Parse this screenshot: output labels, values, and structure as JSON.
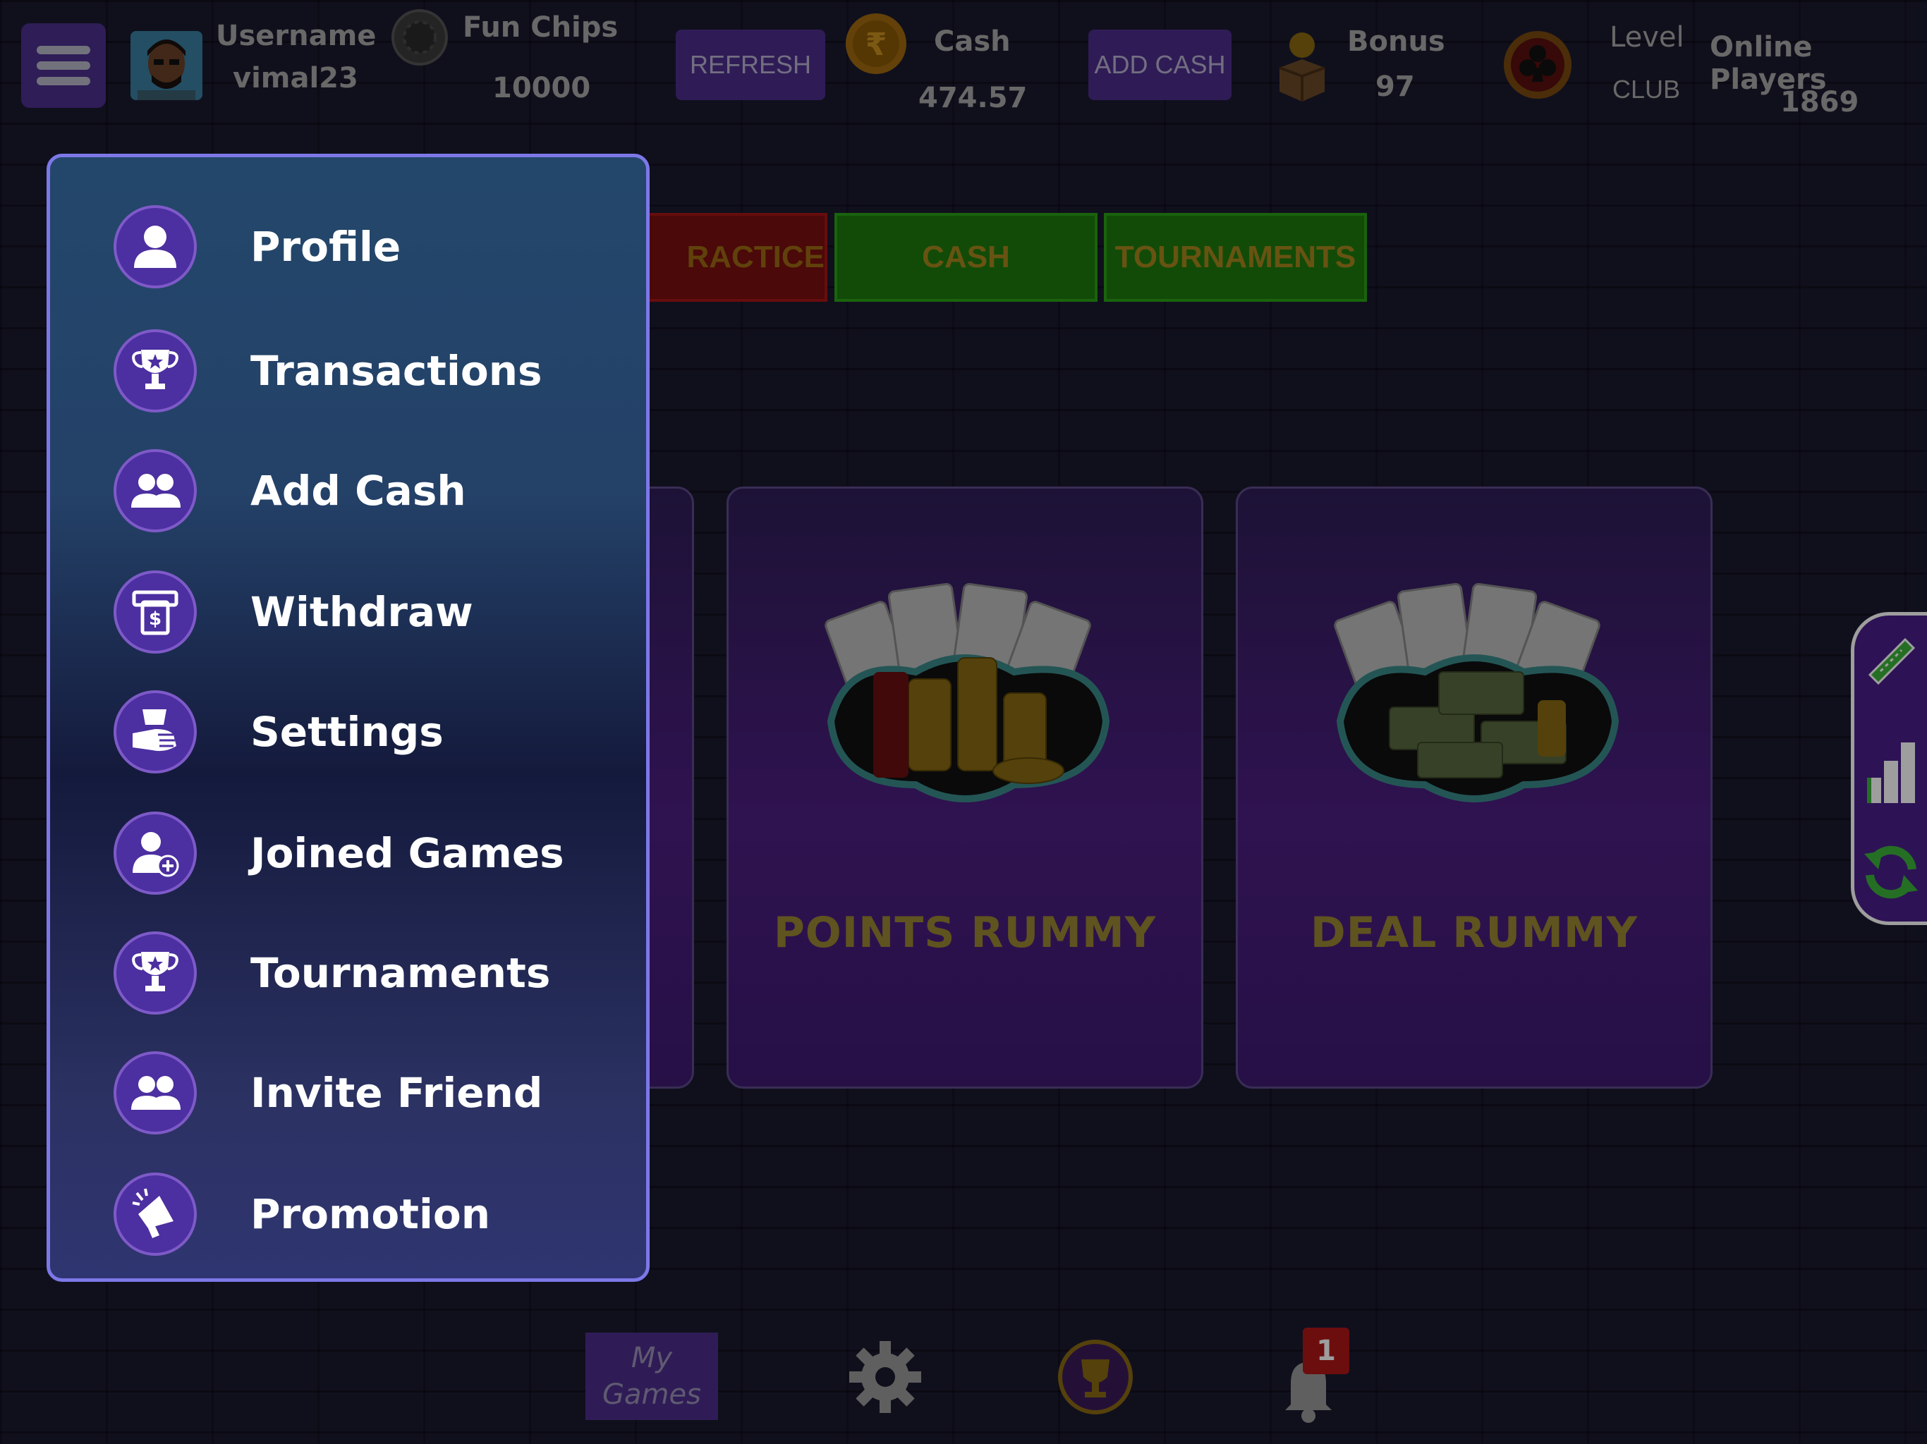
{
  "header": {
    "username_label": "Username",
    "username_value": "vimal23",
    "fun_chips_label": "Fun Chips",
    "fun_chips_value": "10000",
    "refresh_label": "REFRESH",
    "cash_label": "Cash",
    "cash_value": "474.57",
    "add_cash_label": "ADD CASH",
    "bonus_label": "Bonus",
    "bonus_value": "97",
    "level_label": "Level",
    "level_value": "CLUB",
    "online_label": "Online Players",
    "online_value": "1869"
  },
  "tabs": {
    "practice": "RACTICE",
    "cash": "CASH",
    "tournaments": "TOURNAMENTS"
  },
  "cards": {
    "points": "POINTS RUMMY",
    "deal": "DEAL RUMMY"
  },
  "menu": {
    "items": [
      {
        "label": "Profile",
        "icon": "user-icon"
      },
      {
        "label": "Transactions",
        "icon": "trophy-icon"
      },
      {
        "label": "Add Cash",
        "icon": "users-icon"
      },
      {
        "label": "Withdraw",
        "icon": "atm-icon"
      },
      {
        "label": "Settings",
        "icon": "hand-cash-icon"
      },
      {
        "label": "Joined Games",
        "icon": "user-plus-icon"
      },
      {
        "label": "Tournaments",
        "icon": "trophy-icon"
      },
      {
        "label": "Invite Friend",
        "icon": "users-icon"
      },
      {
        "label": "Promotion",
        "icon": "megaphone-icon"
      }
    ]
  },
  "bottom": {
    "my_games_line1": "My",
    "my_games_line2": "Games",
    "notification_count": "1"
  },
  "colors": {
    "accent_purple": "#4d2e8c",
    "drawer_border": "#7d78e8",
    "tab_green": "#1e7a0e",
    "tab_red": "#7a1010"
  }
}
